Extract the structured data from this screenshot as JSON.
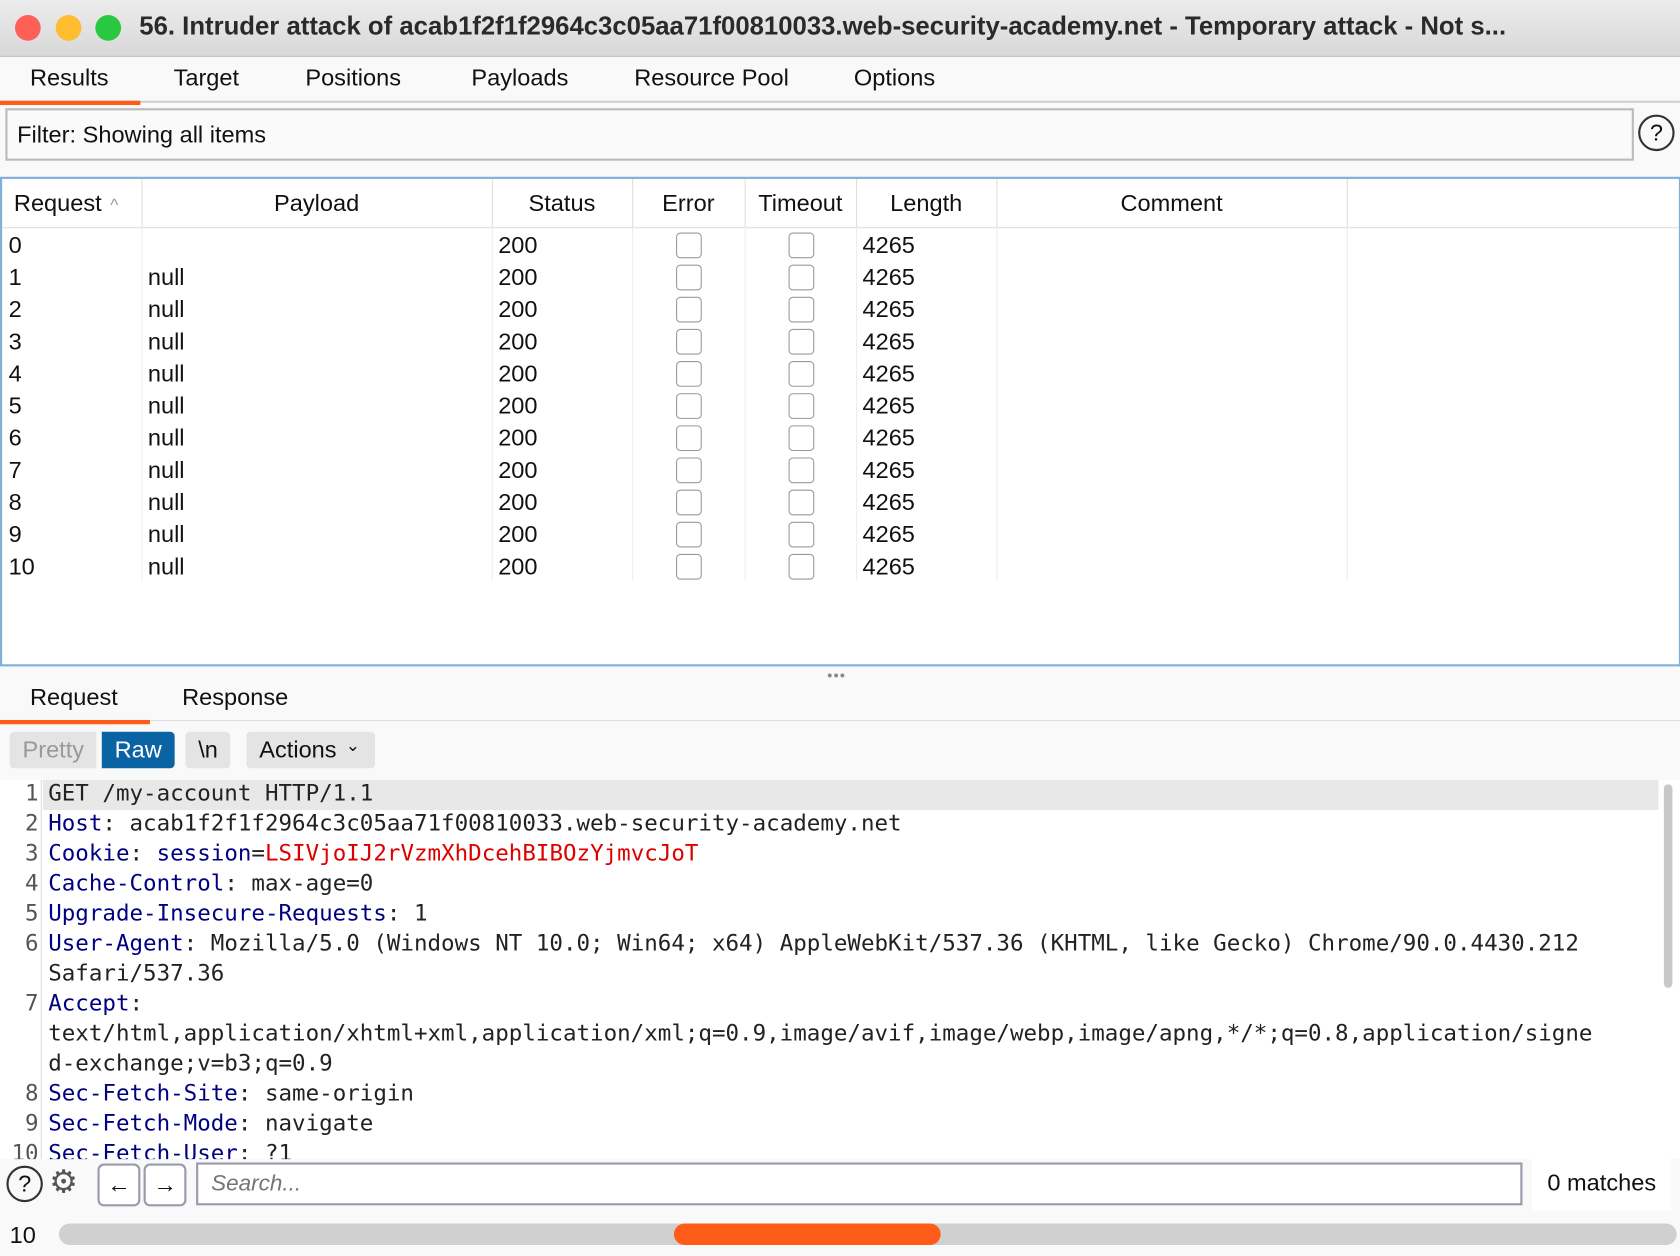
{
  "window": {
    "title": "56. Intruder attack of acab1f2f1f2964c3c05aa71f00810033.web-security-academy.net - Temporary attack - Not s..."
  },
  "tabs": [
    {
      "label": "Results",
      "active": true
    },
    {
      "label": "Target"
    },
    {
      "label": "Positions"
    },
    {
      "label": "Payloads"
    },
    {
      "label": "Resource Pool"
    },
    {
      "label": "Options"
    }
  ],
  "filter": {
    "text": "Filter: Showing all items",
    "help": "?"
  },
  "table": {
    "columns": [
      "Request",
      "Payload",
      "Status",
      "Error",
      "Timeout",
      "Length",
      "Comment"
    ],
    "sort_indicator": "^",
    "rows": [
      {
        "request": "0",
        "payload": "",
        "status": "200",
        "error": false,
        "timeout": false,
        "length": "4265",
        "comment": ""
      },
      {
        "request": "1",
        "payload": "null",
        "status": "200",
        "error": false,
        "timeout": false,
        "length": "4265",
        "comment": ""
      },
      {
        "request": "2",
        "payload": "null",
        "status": "200",
        "error": false,
        "timeout": false,
        "length": "4265",
        "comment": ""
      },
      {
        "request": "3",
        "payload": "null",
        "status": "200",
        "error": false,
        "timeout": false,
        "length": "4265",
        "comment": ""
      },
      {
        "request": "4",
        "payload": "null",
        "status": "200",
        "error": false,
        "timeout": false,
        "length": "4265",
        "comment": ""
      },
      {
        "request": "5",
        "payload": "null",
        "status": "200",
        "error": false,
        "timeout": false,
        "length": "4265",
        "comment": ""
      },
      {
        "request": "6",
        "payload": "null",
        "status": "200",
        "error": false,
        "timeout": false,
        "length": "4265",
        "comment": ""
      },
      {
        "request": "7",
        "payload": "null",
        "status": "200",
        "error": false,
        "timeout": false,
        "length": "4265",
        "comment": ""
      },
      {
        "request": "8",
        "payload": "null",
        "status": "200",
        "error": false,
        "timeout": false,
        "length": "4265",
        "comment": ""
      },
      {
        "request": "9",
        "payload": "null",
        "status": "200",
        "error": false,
        "timeout": false,
        "length": "4265",
        "comment": ""
      },
      {
        "request": "10",
        "payload": "null",
        "status": "200",
        "error": false,
        "timeout": false,
        "length": "4265",
        "comment": ""
      }
    ]
  },
  "detail_tabs": [
    {
      "label": "Request",
      "active": true
    },
    {
      "label": "Response"
    }
  ],
  "toolbar": {
    "pretty": "Pretty",
    "raw": "Raw",
    "newline": "\\n",
    "actions": "Actions"
  },
  "request_lines": [
    {
      "n": "1",
      "key": "",
      "text": "GET /my-account HTTP/1.1"
    },
    {
      "n": "2",
      "key": "Host",
      "text": ": acab1f2f1f2964c3c05aa71f00810033.web-security-academy.net"
    },
    {
      "n": "3",
      "key": "Cookie",
      "text": ": ",
      "ckey": "session",
      "cval": "LSIVjoIJ2rVzmXhDcehBIBOzYjmvcJoT"
    },
    {
      "n": "4",
      "key": "Cache-Control",
      "text": ": max-age=0"
    },
    {
      "n": "5",
      "key": "Upgrade-Insecure-Requests",
      "text": ": 1"
    },
    {
      "n": "6",
      "key": "User-Agent",
      "text": ": Mozilla/5.0 (Windows NT 10.0; Win64; x64) AppleWebKit/537.36 (KHTML, like Gecko) Chrome/90.0.4430.212"
    },
    {
      "n": "",
      "key": "",
      "text": "Safari/537.36"
    },
    {
      "n": "7",
      "key": "Accept",
      "text": ":"
    },
    {
      "n": "",
      "key": "",
      "text": "text/html,application/xhtml+xml,application/xml;q=0.9,image/avif,image/webp,image/apng,*/*;q=0.8,application/signe"
    },
    {
      "n": "",
      "key": "",
      "text": "d-exchange;v=b3;q=0.9"
    },
    {
      "n": "8",
      "key": "Sec-Fetch-Site",
      "text": ": same-origin"
    },
    {
      "n": "9",
      "key": "Sec-Fetch-Mode",
      "text": ": navigate"
    },
    {
      "n": "10",
      "key": "Sec-Fetch-User",
      "text": ": ?1"
    }
  ],
  "search": {
    "placeholder": "Search...",
    "value": "",
    "matches": "0 matches"
  },
  "progress": {
    "count": "10",
    "thumb_start": 0.38,
    "thumb_end": 0.545
  },
  "colors": {
    "accent": "#ff5c1a",
    "raw_active": "#0a64a4",
    "header_key": "#000080",
    "cookie_value": "#dd0000"
  }
}
